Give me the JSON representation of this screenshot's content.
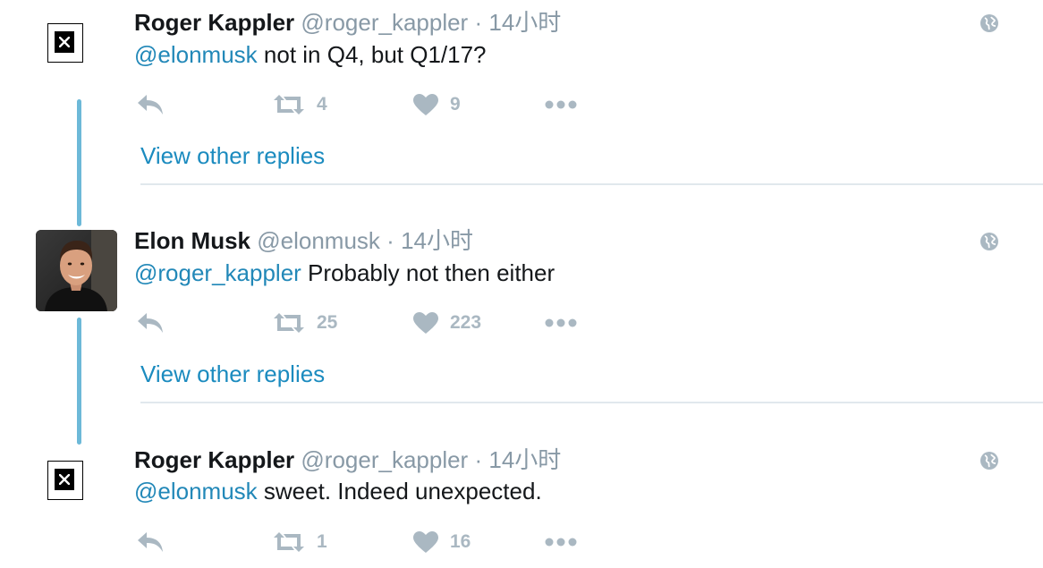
{
  "tweets": [
    {
      "name": "Roger Kappler",
      "handle": "@roger_kappler",
      "separator": "·",
      "time": "14小时",
      "mention": "@elonmusk",
      "text": " not in Q4, but Q1/17?",
      "retweets": "4",
      "likes": "9",
      "avatar": "broken-image-icon"
    },
    {
      "name": "Elon Musk",
      "handle": "@elonmusk",
      "separator": "·",
      "time": "14小时",
      "mention": "@roger_kappler",
      "text": " Probably not then either",
      "retweets": "25",
      "likes": "223",
      "avatar": "profile-photo"
    },
    {
      "name": "Roger Kappler",
      "handle": "@roger_kappler",
      "separator": "·",
      "time": "14小时",
      "mention": "@elonmusk",
      "text": " sweet. Indeed unexpected.",
      "retweets": "1",
      "likes": "16",
      "avatar": "broken-image-icon"
    }
  ],
  "view_other_replies": "View other replies",
  "colors": {
    "link": "#1b8bbf",
    "muted": "#8899a6",
    "action_icon": "#aab8c2",
    "thread_line": "#6db9d8",
    "divider": "#e1e8ed"
  },
  "icons": [
    "reply-icon",
    "retweet-icon",
    "like-icon",
    "more-icon",
    "globe-icon"
  ]
}
